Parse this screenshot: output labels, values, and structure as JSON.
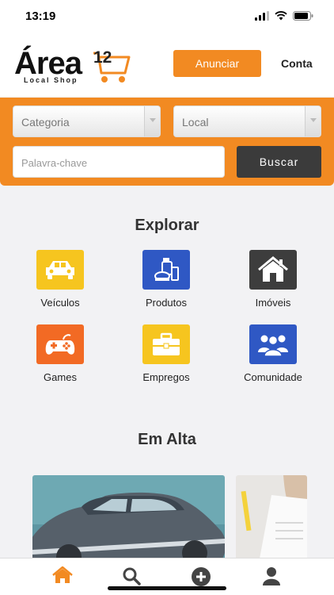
{
  "status_bar": {
    "time": "13:19"
  },
  "header": {
    "logo_main": "Área",
    "logo_number": "12",
    "logo_tagline": "Local Shop",
    "announce_label": "Anunciar",
    "account_label": "Conta"
  },
  "search": {
    "category_placeholder": "Categoria",
    "location_placeholder": "Local",
    "keyword_placeholder": "Palavra-chave",
    "search_label": "Buscar"
  },
  "explore": {
    "title": "Explorar",
    "categories": [
      {
        "label": "Veículos",
        "icon": "car-icon",
        "color": "#f6c51f"
      },
      {
        "label": "Produtos",
        "icon": "products-icon",
        "color": "#2f58c4"
      },
      {
        "label": "Imóveis",
        "icon": "house-icon",
        "color": "#3d3d3d"
      },
      {
        "label": "Games",
        "icon": "gamepad-icon",
        "color": "#f26a24"
      },
      {
        "label": "Empregos",
        "icon": "briefcase-icon",
        "color": "#f6c51f"
      },
      {
        "label": "Comunidade",
        "icon": "community-icon",
        "color": "#2f58c4"
      }
    ]
  },
  "trending": {
    "title": "Em Alta"
  },
  "colors": {
    "accent": "#f28a22",
    "dark": "#3b3b3b",
    "blue": "#2f58c4",
    "yellow": "#f6c51f"
  },
  "tabbar": {
    "items": [
      {
        "icon": "home-icon",
        "active": true
      },
      {
        "icon": "search-icon",
        "active": false
      },
      {
        "icon": "add-circle-icon",
        "active": false
      },
      {
        "icon": "profile-icon",
        "active": false
      }
    ]
  }
}
